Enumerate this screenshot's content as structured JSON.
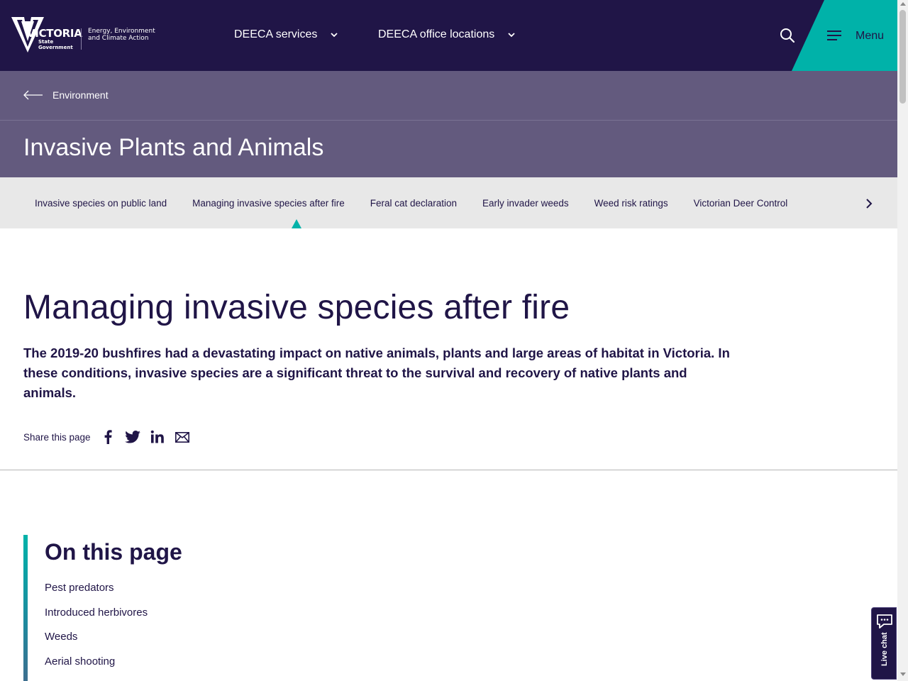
{
  "header": {
    "logo": {
      "wordmark": "VICTORIA",
      "sub": "State Government",
      "department": "Energy, Environment and Climate Action"
    },
    "nav": [
      {
        "label": "DEECA services",
        "icon": "chevron-down-icon"
      },
      {
        "label": "DEECA office locations",
        "icon": "chevron-down-icon"
      }
    ],
    "search_icon": "search-icon",
    "menu_label": "Menu",
    "menu_icon": "hamburger-icon"
  },
  "breadcrumb": {
    "label": "Environment",
    "icon": "arrow-left-icon"
  },
  "section_title": "Invasive Plants and Animals",
  "subnav": {
    "items": [
      {
        "label": "Invasive species on public land",
        "active": false
      },
      {
        "label": "Managing invasive species after fire",
        "active": true
      },
      {
        "label": "Feral cat declaration",
        "active": false
      },
      {
        "label": "Early invader weeds",
        "active": false
      },
      {
        "label": "Weed risk ratings",
        "active": false
      },
      {
        "label": "Victorian Deer Control",
        "active": false
      }
    ],
    "next_icon": "chevron-right-icon"
  },
  "main": {
    "title": "Managing invasive species after fire",
    "intro": "The 2019-20 bushfires had a devastating impact on native animals, plants and large areas of habitat in Victoria. In these conditions, invasive species are a significant threat to the survival and recovery of native plants and animals.",
    "share": {
      "label": "Share this page",
      "icons": [
        "facebook-icon",
        "twitter-icon",
        "linkedin-icon",
        "email-icon"
      ]
    }
  },
  "toc": {
    "title": "On this page",
    "links": [
      "Pest predators",
      "Introduced herbivores",
      "Weeds",
      "Aerial shooting"
    ]
  },
  "live_chat": {
    "label": "Live chat",
    "icon": "chat-bubble-icon"
  },
  "colors": {
    "navy": "#201547",
    "purple_band": "#635a7e",
    "teal": "#00b2a9",
    "subnav_bg": "#e8e8e8"
  }
}
